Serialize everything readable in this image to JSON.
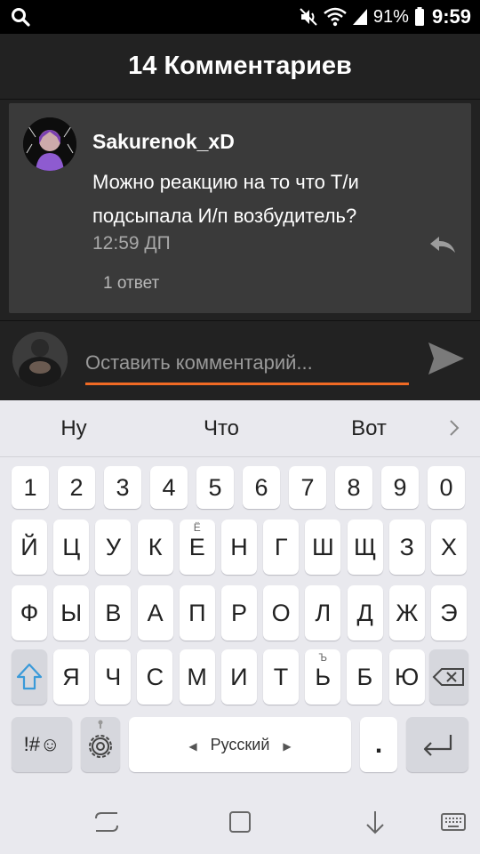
{
  "status": {
    "battery": "91%",
    "time": "9:59"
  },
  "header": {
    "title": "14 Комментариев"
  },
  "comment": {
    "author": "Sakurenok_xD",
    "text": "Можно реакцию на то что Т/и подсыпала И/п возбудитель?",
    "time": "12:59 ДП",
    "replies": "1 ответ"
  },
  "input": {
    "placeholder": "Оставить комментарий..."
  },
  "suggestions": [
    "Ну",
    "Что",
    "Вот"
  ],
  "keys": {
    "row_numbers": [
      "1",
      "2",
      "3",
      "4",
      "5",
      "6",
      "7",
      "8",
      "9",
      "0"
    ],
    "row1": [
      "Й",
      "Ц",
      "У",
      "К",
      "Е",
      "Н",
      "Г",
      "Ш",
      "Щ",
      "З",
      "Х"
    ],
    "row1_sub": {
      "4": "Ё"
    },
    "row2": [
      "Ф",
      "Ы",
      "В",
      "А",
      "П",
      "Р",
      "О",
      "Л",
      "Д",
      "Ж",
      "Э"
    ],
    "row3": [
      "Я",
      "Ч",
      "С",
      "М",
      "И",
      "Т",
      "Ь",
      "Б",
      "Ю"
    ],
    "row3_sub": {
      "6": "Ъ"
    },
    "symbols_label": "!#☺",
    "space_label": "Русский",
    "period": "."
  },
  "colors": {
    "accent": "#f06a24",
    "card": "#3a3a3a",
    "background": "#222222"
  },
  "icons": {
    "search": "search-icon",
    "mute": "mute-icon",
    "wifi": "wifi-icon",
    "signal": "signal-icon",
    "battery": "battery-icon",
    "reply": "reply-icon",
    "send": "send-icon",
    "chevron": "chevron-right-icon",
    "shift": "shift-icon",
    "backspace": "backspace-icon",
    "settings": "gear-icon",
    "enter": "enter-icon",
    "nav_recents": "recents-icon",
    "nav_home": "home-icon",
    "nav_back": "back-icon",
    "nav_keyboard": "keyboard-icon"
  }
}
